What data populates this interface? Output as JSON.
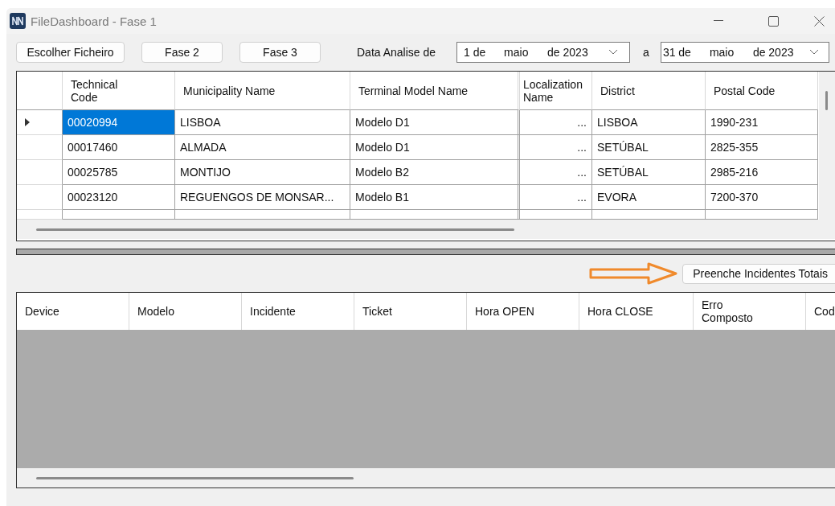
{
  "window": {
    "title": "FileDashboard - Fase 1"
  },
  "toolbar": {
    "buttons": [
      "Escolher Ficheiro",
      "Fase 2",
      "Fase 3"
    ],
    "date_label": "Data Analise de",
    "date_from": {
      "day": "1 de",
      "month": "maio",
      "year": "de 2023"
    },
    "range_separator": "a",
    "date_to": {
      "day": "31 de",
      "month": "maio",
      "year": "de 2023"
    }
  },
  "terminals_table": {
    "columns": [
      "Technical Code",
      "Municipality Name",
      "Terminal Model Name",
      "Localization Name",
      "District",
      "Postal Code"
    ],
    "rows": [
      {
        "selected": true,
        "cells": [
          "00020994",
          "LISBOA",
          "Modelo D1",
          "...",
          "LISBOA",
          "1990-231"
        ]
      },
      {
        "selected": false,
        "cells": [
          "00017460",
          "ALMADA",
          "Modelo D1",
          "...",
          "SETÚBAL",
          "2825-355"
        ]
      },
      {
        "selected": false,
        "cells": [
          "00025785",
          "MONTIJO",
          "Modelo B2",
          "...",
          "SETÚBAL",
          "2985-216"
        ]
      },
      {
        "selected": false,
        "cells": [
          "00023120",
          "REGUENGOS DE MONSAR...",
          "Modelo B1",
          "...",
          "EVORA",
          "7200-370"
        ]
      }
    ]
  },
  "action_button": "Preenche Incidentes Totais",
  "incidents_table": {
    "columns": [
      "Device",
      "Modelo",
      "Incidente",
      "Ticket",
      "Hora OPEN",
      "Hora CLOSE",
      "Erro Composto",
      "Cod"
    ]
  }
}
